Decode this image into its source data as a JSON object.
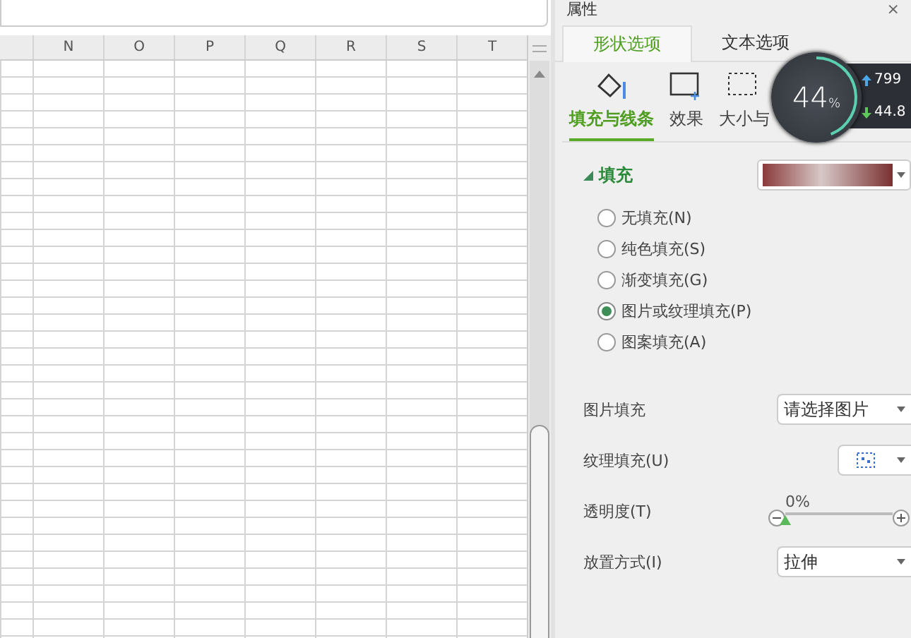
{
  "sheet": {
    "columns": [
      "N",
      "O",
      "P",
      "Q",
      "R",
      "S",
      "T"
    ]
  },
  "panel": {
    "title": "属性",
    "close": "×",
    "tabs": [
      {
        "label": "形状选项",
        "selected": true
      },
      {
        "label": "文本选项",
        "selected": false
      }
    ],
    "subtabs": [
      {
        "label": "填充与线条",
        "kind": "fill",
        "selected": true
      },
      {
        "label": "效果",
        "kind": "effect",
        "selected": false
      },
      {
        "label": "大小与",
        "kind": "size",
        "selected": false
      }
    ],
    "section": {
      "title": "填充",
      "expanded": true
    },
    "radios": [
      {
        "label": "无填充(N)",
        "selected": false
      },
      {
        "label": "纯色填充(S)",
        "selected": false
      },
      {
        "label": "渐变填充(G)",
        "selected": false
      },
      {
        "label": "图片或纹理填充(P)",
        "selected": true
      },
      {
        "label": "图案填充(A)",
        "selected": false
      }
    ],
    "picture_fill": {
      "label": "图片填充",
      "value": "请选择图片"
    },
    "texture_fill": {
      "label": "纹理填充(U)"
    },
    "transparency": {
      "label": "透明度(T)",
      "reading": "0%",
      "level": 0
    },
    "placement": {
      "label": "放置方式(I)",
      "value": "拉伸"
    }
  },
  "speed_widget": {
    "percent": "44",
    "unit": "%",
    "upload": "799",
    "download": "44.8"
  }
}
